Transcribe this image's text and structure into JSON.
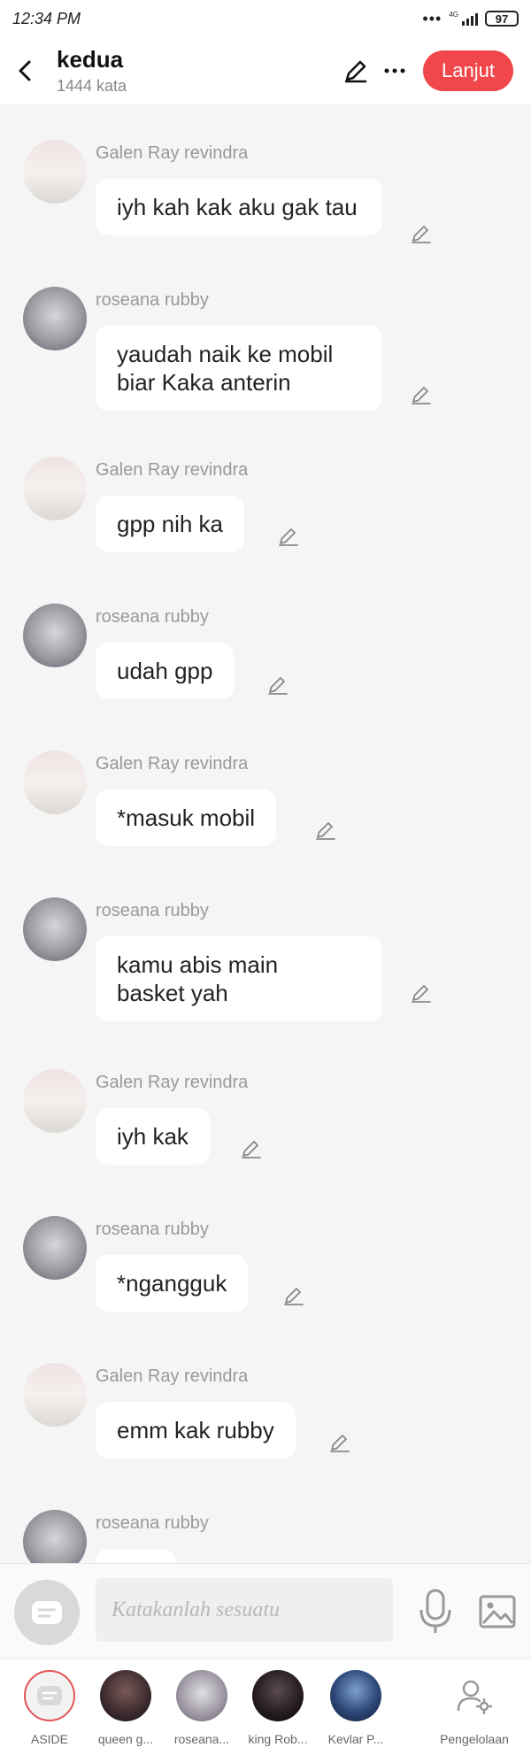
{
  "status": {
    "time": "12:34 PM",
    "network": "4G",
    "battery": "97"
  },
  "header": {
    "title": "kedua",
    "word_count": "1444 kata",
    "next_label": "Lanjut"
  },
  "messages": [
    {
      "sender": "Galen Ray revindra",
      "text": "iyh kah kak aku gak tau",
      "avatar": "galen"
    },
    {
      "sender": "roseana rubby",
      "text": "yaudah naik ke mobil\nbiar Kaka anterin",
      "avatar": "rosie"
    },
    {
      "sender": "Galen Ray revindra",
      "text": "gpp nih ka",
      "avatar": "galen"
    },
    {
      "sender": "roseana rubby",
      "text": "udah gpp",
      "avatar": "rosie"
    },
    {
      "sender": "Galen Ray revindra",
      "text": "*masuk mobil",
      "avatar": "galen"
    },
    {
      "sender": "roseana rubby",
      "text": "kamu abis main\nbasket yah",
      "avatar": "rosie"
    },
    {
      "sender": "Galen Ray revindra",
      "text": "iyh kak",
      "avatar": "galen"
    },
    {
      "sender": "roseana rubby",
      "text": "*ngangguk",
      "avatar": "rosie"
    },
    {
      "sender": "Galen Ray revindra",
      "text": "emm kak rubby",
      "avatar": "galen"
    },
    {
      "sender": "roseana rubby",
      "text": "",
      "avatar": "rosie"
    }
  ],
  "input": {
    "placeholder": "Katakanlah sesuatu"
  },
  "characters": [
    {
      "name": "ASIDE"
    },
    {
      "name": "queen g..."
    },
    {
      "name": "roseana..."
    },
    {
      "name": "king Rob..."
    },
    {
      "name": "Kevlar P..."
    },
    {
      "name": "Pengelolaan"
    }
  ],
  "colors": {
    "accent": "#f2474a",
    "background": "#f5f5f5",
    "bubble": "#ffffff"
  }
}
